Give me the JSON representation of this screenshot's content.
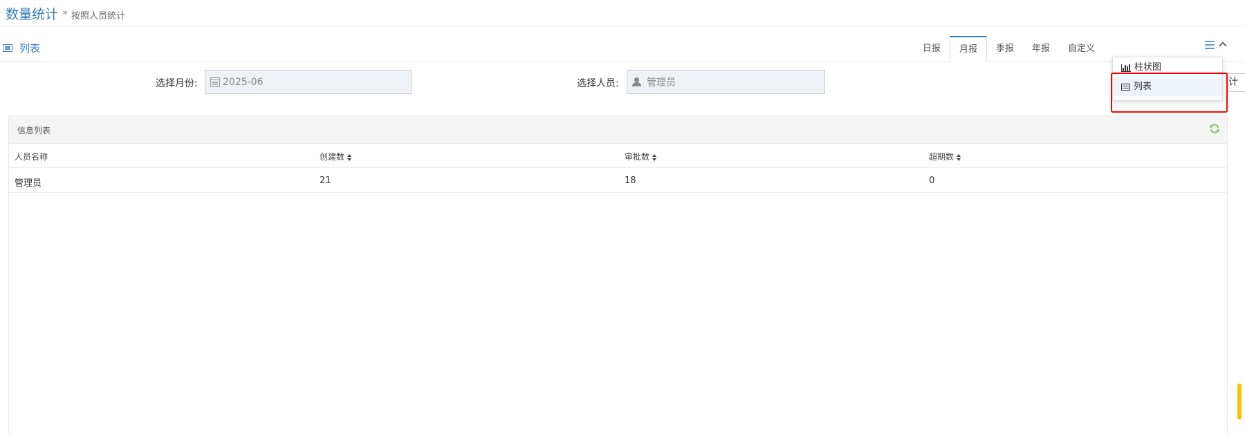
{
  "header": {
    "title": "数量统计",
    "separator": "»",
    "subtitle": "按照人员统计"
  },
  "portlet": {
    "title": "列表",
    "tabs": [
      {
        "label": "日报",
        "active": false
      },
      {
        "label": "月报",
        "active": true
      },
      {
        "label": "季报",
        "active": false
      },
      {
        "label": "年报",
        "active": false
      },
      {
        "label": "自定义",
        "active": false
      }
    ],
    "view_menu": {
      "items": [
        {
          "label": "柱状图",
          "icon": "bar-chart-icon"
        },
        {
          "label": "列表",
          "icon": "table-icon",
          "active": true
        }
      ]
    }
  },
  "filters": {
    "month_label": "选择月份:",
    "month_value": "2025-06",
    "person_label": "选择人员:",
    "person_value": "管理员",
    "stat_button_partial": "计"
  },
  "table": {
    "title": "信息列表",
    "columns": [
      "人员名称",
      "创建数",
      "审批数",
      "超期数"
    ],
    "rows": [
      {
        "name": "管理员",
        "created": "21",
        "approved": "18",
        "overdue": "0"
      }
    ]
  },
  "colors": {
    "accent": "#337ab7",
    "highlight": "#ff0000",
    "refresh": "#8cc474"
  }
}
